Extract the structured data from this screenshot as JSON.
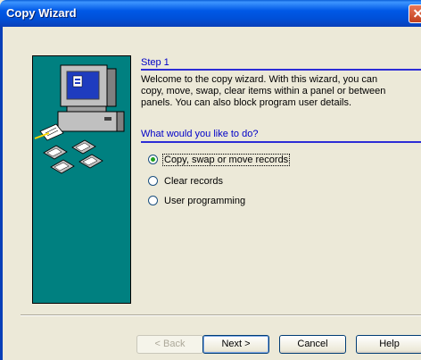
{
  "window": {
    "title": "Copy Wizard"
  },
  "wizard": {
    "step_label": "Step 1",
    "welcome_text": "Welcome to the copy wizard. With this wizard, you can copy, move, swap, clear items within a panel or between panels. You can also block program user details.",
    "question": "What would you like to do?",
    "options": [
      {
        "label": "Copy, swap or move records",
        "selected": true
      },
      {
        "label": "Clear records",
        "selected": false
      },
      {
        "label": "User programming",
        "selected": false
      }
    ]
  },
  "buttons": {
    "back": "< Back",
    "next": "Next >",
    "cancel": "Cancel",
    "help": "Help"
  },
  "colors": {
    "title_bar": "#0058e6",
    "art_panel": "#008080",
    "heading_text": "#0000c8"
  }
}
